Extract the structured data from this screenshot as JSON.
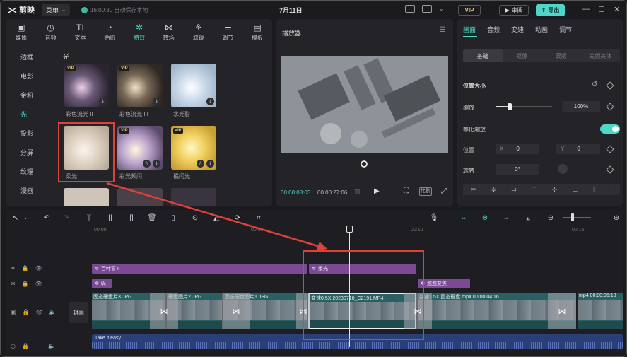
{
  "app": {
    "name": "剪映",
    "menu_label": "菜单",
    "save_status": "16:00:30 自动保存本地",
    "project_title": "7月11日",
    "vip_label": "VIP",
    "review_label": "审阅",
    "export_label": "导出"
  },
  "media_tabs": [
    {
      "label": "媒体",
      "icon": "media-icon"
    },
    {
      "label": "音频",
      "icon": "audio-icon"
    },
    {
      "label": "文本",
      "icon": "text-icon"
    },
    {
      "label": "贴纸",
      "icon": "sticker-icon"
    },
    {
      "label": "特效",
      "icon": "effects-icon",
      "active": true
    },
    {
      "label": "转场",
      "icon": "transition-icon"
    },
    {
      "label": "滤镜",
      "icon": "filter-icon"
    },
    {
      "label": "调节",
      "icon": "adjust-icon"
    },
    {
      "label": "模板",
      "icon": "template-icon"
    }
  ],
  "effect_categories": [
    "边框",
    "电影",
    "金粉",
    "光",
    "投影",
    "分屏",
    "纹理",
    "漫画"
  ],
  "active_category": "光",
  "section_title": "光",
  "effects": [
    {
      "label": "彩色流光 II",
      "vip": true
    },
    {
      "label": "彩色流光 III",
      "vip": true
    },
    {
      "label": "水光影",
      "vip": false
    },
    {
      "label": "柔光",
      "vip": false,
      "selected": true
    },
    {
      "label": "彩光频闪",
      "vip": true
    },
    {
      "label": "橘闪光",
      "vip": true
    }
  ],
  "player": {
    "title": "播放器",
    "current_time": "00:00:08:03",
    "total_time": "00:00:27:06",
    "ratio_label": "比例"
  },
  "properties": {
    "tabs": [
      "画面",
      "音频",
      "变速",
      "动画",
      "调节"
    ],
    "active_tab": "画面",
    "subtabs": [
      "基础",
      "抠像",
      "蒙版",
      "美颜美体"
    ],
    "active_subtab": "基础",
    "section_position_size": "位置大小",
    "scale_label": "缩放",
    "scale_value": "100%",
    "scale_level": 0.25,
    "uniform_scale_label": "等比缩放",
    "position_label": "位置",
    "pos_x_label": "X",
    "pos_x_value": "0",
    "pos_y_label": "Y",
    "pos_y_value": "0",
    "rotate_label": "旋转",
    "rotate_value": "0°"
  },
  "timeline": {
    "ruler": [
      "00:00",
      "00:05",
      "00:10",
      "00:15"
    ],
    "cover_label": "封面",
    "effect_track_1": [
      {
        "label": "百叶窗 II"
      },
      {
        "label": "柔光"
      }
    ],
    "effect_track_2": [
      {
        "label": "纵"
      },
      {
        "label": "泡泡变焦"
      }
    ],
    "video_clips": [
      {
        "label": "固态硬盘片3.JPG"
      },
      {
        "label": "硬盘图片2.JPG"
      },
      {
        "label": "固态硬盘图片1.JPG"
      },
      {
        "label": "变速0.5X  20230710_C2191.MP4"
      },
      {
        "label": "变速1.5X  固态硬盘.mp4  00:00:04:16"
      },
      {
        "label": "mp4  00:00:05:18"
      }
    ],
    "audio_label": "Take it easy"
  }
}
